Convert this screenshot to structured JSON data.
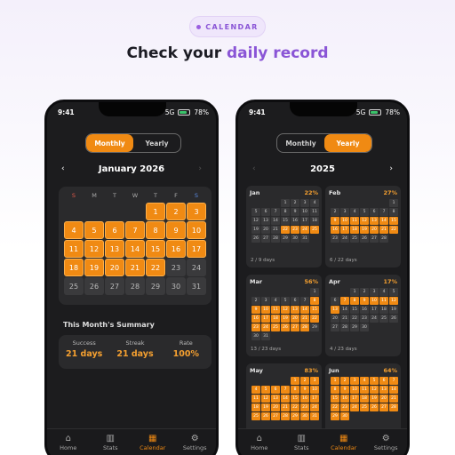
{
  "header": {
    "chip_label": "CALENDAR",
    "headline_prefix": "Check your ",
    "headline_highlight": "daily record"
  },
  "status_bar": {
    "time": "9:41",
    "network": "5G",
    "battery": "78%"
  },
  "toggle": {
    "monthly": "Monthly",
    "yearly": "Yearly"
  },
  "monthly": {
    "prev_arrow": "‹",
    "next_arrow": "›",
    "title": "January 2026",
    "weekdays": [
      "S",
      "M",
      "T",
      "W",
      "T",
      "F",
      "S"
    ],
    "leading_blanks": 4,
    "days_in_month": 31,
    "completed_days": [
      1,
      2,
      3,
      4,
      5,
      6,
      7,
      8,
      9,
      10,
      11,
      12,
      13,
      14,
      15,
      16,
      17,
      18,
      19,
      20,
      21,
      22
    ],
    "summary": {
      "title": "This Month's Summary",
      "items": [
        {
          "label": "Success",
          "value": "21 days"
        },
        {
          "label": "Streak",
          "value": "21 days"
        },
        {
          "label": "Rate",
          "value": "100%"
        }
      ]
    }
  },
  "yearly": {
    "title": "2025",
    "prev_arrow": "‹",
    "next_arrow": "›",
    "months": [
      {
        "name": "Jan",
        "pct": "22%",
        "footer": "2 / 9 days"
      },
      {
        "name": "Feb",
        "pct": "27%",
        "footer": "6 / 22 days"
      },
      {
        "name": "Mar",
        "pct": "56%",
        "footer": "13 / 23 days"
      },
      {
        "name": "Apr",
        "pct": "17%",
        "footer": "4 / 23 days"
      },
      {
        "name": "May",
        "pct": "83%",
        "footer": ""
      },
      {
        "name": "Jun",
        "pct": "64%",
        "footer": ""
      }
    ]
  },
  "tabbar": {
    "items": [
      {
        "label": "Home",
        "icon": "home-icon"
      },
      {
        "label": "Stats",
        "icon": "stats-icon"
      },
      {
        "label": "Calendar",
        "icon": "calendar-icon"
      },
      {
        "label": "Settings",
        "icon": "gear-icon"
      }
    ],
    "active": "Calendar"
  },
  "colors": {
    "accent": "#f08a13",
    "purple": "#8a55d6",
    "sunday": "#e25a4a",
    "saturday": "#5a8ae2"
  }
}
